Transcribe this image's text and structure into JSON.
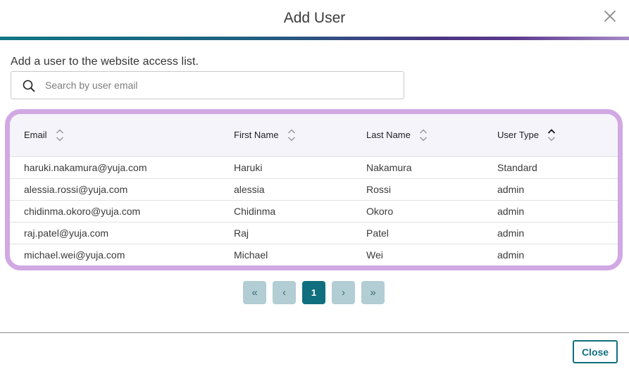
{
  "dialog": {
    "title": "Add User",
    "subtitle": "Add a user to the website access list.",
    "close_label": "Close"
  },
  "search": {
    "placeholder": "Search by user email",
    "value": ""
  },
  "table": {
    "columns": [
      {
        "label": "Email",
        "sort": "none"
      },
      {
        "label": "First Name",
        "sort": "none"
      },
      {
        "label": "Last Name",
        "sort": "none"
      },
      {
        "label": "User Type",
        "sort": "ascending"
      }
    ],
    "rows": [
      {
        "email": "haruki.nakamura@yuja.com",
        "first": "Haruki",
        "last": "Nakamura",
        "type": "Standard"
      },
      {
        "email": "alessia.rossi@yuja.com",
        "first": "alessia",
        "last": "Rossi",
        "type": "admin"
      },
      {
        "email": "chidinma.okoro@yuja.com",
        "first": "Chidinma",
        "last": "Okoro",
        "type": "admin"
      },
      {
        "email": "raj.patel@yuja.com",
        "first": "Raj",
        "last": "Patel",
        "type": "admin"
      },
      {
        "email": "michael.wei@yuja.com",
        "first": "Michael",
        "last": "Wei",
        "type": "admin"
      }
    ]
  },
  "pagination": {
    "first": "«",
    "prev": "‹",
    "current": "1",
    "next": "›",
    "last": "»"
  },
  "colors": {
    "accent": "#106f7e",
    "highlight_border": "#d1a8e4",
    "pager_inactive": "#b2cdd3"
  },
  "icons": {
    "close": "close-icon",
    "search": "search-icon",
    "sort": "sort-icon"
  }
}
